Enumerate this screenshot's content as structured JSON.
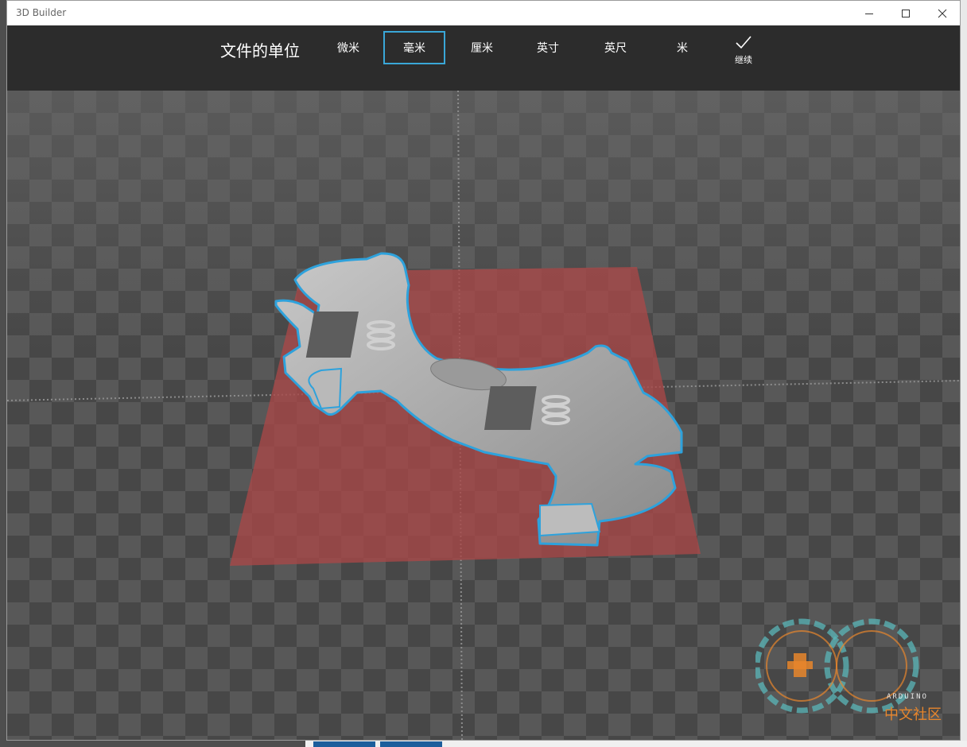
{
  "window": {
    "title": "3D Builder"
  },
  "window_controls": {
    "minimize": "—",
    "maximize": "☐",
    "close": "✕"
  },
  "units": {
    "heading": "文件的单位",
    "options": [
      {
        "label": "微米",
        "selected": false
      },
      {
        "label": "毫米",
        "selected": true
      },
      {
        "label": "厘米",
        "selected": false
      },
      {
        "label": "英寸",
        "selected": false
      },
      {
        "label": "英尺",
        "selected": false
      },
      {
        "label": "米",
        "selected": false
      }
    ],
    "continue_label": "继续"
  },
  "watermark": {
    "brand": "ARDUINO",
    "text": "中文社区"
  },
  "colors": {
    "accent": "#3aa7d8",
    "toolbar": "#2c2c2c",
    "build_plate": "#a94848"
  }
}
